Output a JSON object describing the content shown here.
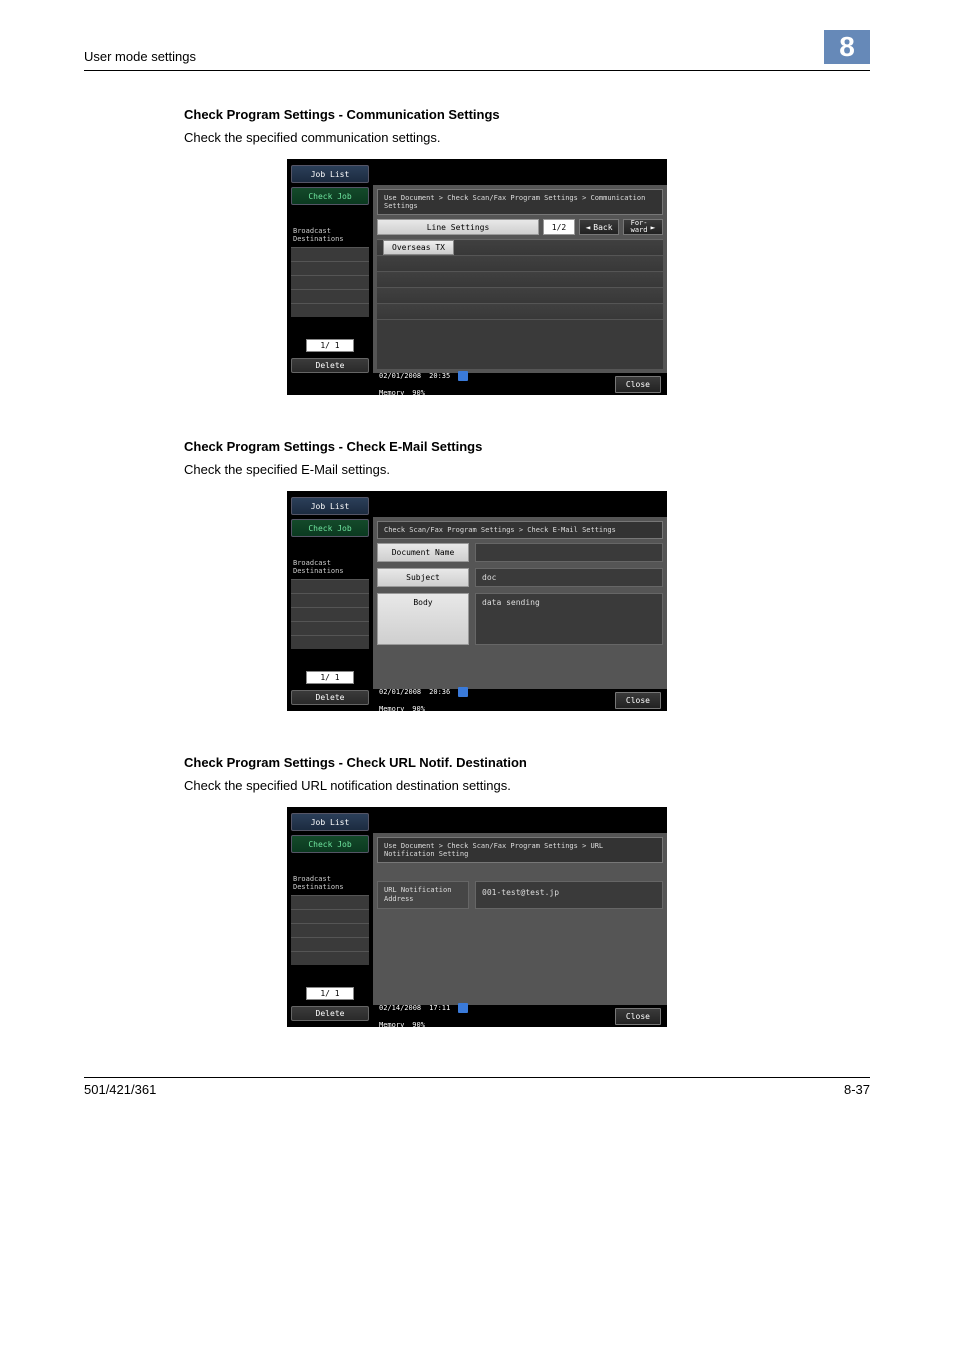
{
  "header": {
    "left": "User mode settings",
    "chapter": "8"
  },
  "sections": [
    {
      "title": "Check Program Settings - Communication Settings",
      "desc": "Check the specified communication settings."
    },
    {
      "title": "Check Program Settings - Check E-Mail Settings",
      "desc": "Check the specified E-Mail settings."
    },
    {
      "title": "Check Program Settings - Check URL Notif. Destination",
      "desc": "Check the specified URL notification destination settings."
    }
  ],
  "panel_shared": {
    "job_list": "Job List",
    "check_job": "Check Job",
    "broadcast": "Broadcast\nDestinations",
    "page": "1/  1",
    "delete": "Delete",
    "memory_label": "Memory",
    "memory_pct": "90%",
    "close": "Close"
  },
  "panel1": {
    "crumb": "Use Document > Check Scan/Fax Program Settings > Communication Settings",
    "line_settings": "Line Settings",
    "page_indicator": "1/2",
    "back": "Back",
    "forward": "For-\nward",
    "overseas": "Overseas TX",
    "date": "02/01/2008",
    "time": "20:35"
  },
  "panel2": {
    "crumb": "Check Scan/Fax Program Settings > Check E-Mail Settings",
    "doc_name_label": "Document Name",
    "doc_name_value": "",
    "subject_label": "Subject",
    "subject_value": "doc",
    "body_label": "Body",
    "body_value": "data sending",
    "date": "02/01/2008",
    "time": "20:36"
  },
  "panel3": {
    "crumb": "Use Document > Check Scan/Fax Program Settings > URL Notification Setting",
    "url_label": "URL Notification\nAddress",
    "url_value": "001-test@test.jp",
    "date": "02/14/2008",
    "time": "17:11"
  },
  "footer": {
    "left": "501/421/361",
    "right": "8-37"
  }
}
